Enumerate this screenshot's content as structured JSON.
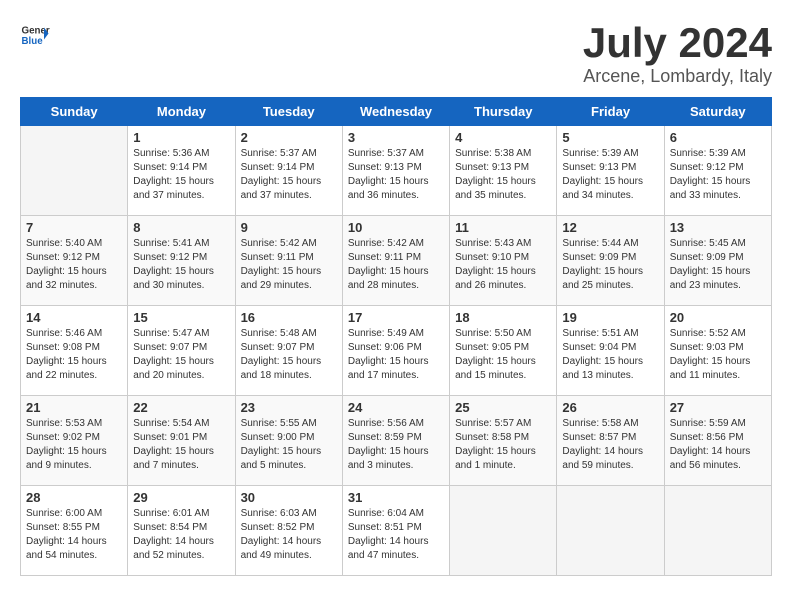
{
  "header": {
    "logo_general": "General",
    "logo_blue": "Blue",
    "month": "July 2024",
    "location": "Arcene, Lombardy, Italy"
  },
  "weekdays": [
    "Sunday",
    "Monday",
    "Tuesday",
    "Wednesday",
    "Thursday",
    "Friday",
    "Saturday"
  ],
  "weeks": [
    [
      {
        "day": "",
        "info": ""
      },
      {
        "day": "1",
        "info": "Sunrise: 5:36 AM\nSunset: 9:14 PM\nDaylight: 15 hours\nand 37 minutes."
      },
      {
        "day": "2",
        "info": "Sunrise: 5:37 AM\nSunset: 9:14 PM\nDaylight: 15 hours\nand 37 minutes."
      },
      {
        "day": "3",
        "info": "Sunrise: 5:37 AM\nSunset: 9:13 PM\nDaylight: 15 hours\nand 36 minutes."
      },
      {
        "day": "4",
        "info": "Sunrise: 5:38 AM\nSunset: 9:13 PM\nDaylight: 15 hours\nand 35 minutes."
      },
      {
        "day": "5",
        "info": "Sunrise: 5:39 AM\nSunset: 9:13 PM\nDaylight: 15 hours\nand 34 minutes."
      },
      {
        "day": "6",
        "info": "Sunrise: 5:39 AM\nSunset: 9:12 PM\nDaylight: 15 hours\nand 33 minutes."
      }
    ],
    [
      {
        "day": "7",
        "info": "Sunrise: 5:40 AM\nSunset: 9:12 PM\nDaylight: 15 hours\nand 32 minutes."
      },
      {
        "day": "8",
        "info": "Sunrise: 5:41 AM\nSunset: 9:12 PM\nDaylight: 15 hours\nand 30 minutes."
      },
      {
        "day": "9",
        "info": "Sunrise: 5:42 AM\nSunset: 9:11 PM\nDaylight: 15 hours\nand 29 minutes."
      },
      {
        "day": "10",
        "info": "Sunrise: 5:42 AM\nSunset: 9:11 PM\nDaylight: 15 hours\nand 28 minutes."
      },
      {
        "day": "11",
        "info": "Sunrise: 5:43 AM\nSunset: 9:10 PM\nDaylight: 15 hours\nand 26 minutes."
      },
      {
        "day": "12",
        "info": "Sunrise: 5:44 AM\nSunset: 9:09 PM\nDaylight: 15 hours\nand 25 minutes."
      },
      {
        "day": "13",
        "info": "Sunrise: 5:45 AM\nSunset: 9:09 PM\nDaylight: 15 hours\nand 23 minutes."
      }
    ],
    [
      {
        "day": "14",
        "info": "Sunrise: 5:46 AM\nSunset: 9:08 PM\nDaylight: 15 hours\nand 22 minutes."
      },
      {
        "day": "15",
        "info": "Sunrise: 5:47 AM\nSunset: 9:07 PM\nDaylight: 15 hours\nand 20 minutes."
      },
      {
        "day": "16",
        "info": "Sunrise: 5:48 AM\nSunset: 9:07 PM\nDaylight: 15 hours\nand 18 minutes."
      },
      {
        "day": "17",
        "info": "Sunrise: 5:49 AM\nSunset: 9:06 PM\nDaylight: 15 hours\nand 17 minutes."
      },
      {
        "day": "18",
        "info": "Sunrise: 5:50 AM\nSunset: 9:05 PM\nDaylight: 15 hours\nand 15 minutes."
      },
      {
        "day": "19",
        "info": "Sunrise: 5:51 AM\nSunset: 9:04 PM\nDaylight: 15 hours\nand 13 minutes."
      },
      {
        "day": "20",
        "info": "Sunrise: 5:52 AM\nSunset: 9:03 PM\nDaylight: 15 hours\nand 11 minutes."
      }
    ],
    [
      {
        "day": "21",
        "info": "Sunrise: 5:53 AM\nSunset: 9:02 PM\nDaylight: 15 hours\nand 9 minutes."
      },
      {
        "day": "22",
        "info": "Sunrise: 5:54 AM\nSunset: 9:01 PM\nDaylight: 15 hours\nand 7 minutes."
      },
      {
        "day": "23",
        "info": "Sunrise: 5:55 AM\nSunset: 9:00 PM\nDaylight: 15 hours\nand 5 minutes."
      },
      {
        "day": "24",
        "info": "Sunrise: 5:56 AM\nSunset: 8:59 PM\nDaylight: 15 hours\nand 3 minutes."
      },
      {
        "day": "25",
        "info": "Sunrise: 5:57 AM\nSunset: 8:58 PM\nDaylight: 15 hours\nand 1 minute."
      },
      {
        "day": "26",
        "info": "Sunrise: 5:58 AM\nSunset: 8:57 PM\nDaylight: 14 hours\nand 59 minutes."
      },
      {
        "day": "27",
        "info": "Sunrise: 5:59 AM\nSunset: 8:56 PM\nDaylight: 14 hours\nand 56 minutes."
      }
    ],
    [
      {
        "day": "28",
        "info": "Sunrise: 6:00 AM\nSunset: 8:55 PM\nDaylight: 14 hours\nand 54 minutes."
      },
      {
        "day": "29",
        "info": "Sunrise: 6:01 AM\nSunset: 8:54 PM\nDaylight: 14 hours\nand 52 minutes."
      },
      {
        "day": "30",
        "info": "Sunrise: 6:03 AM\nSunset: 8:52 PM\nDaylight: 14 hours\nand 49 minutes."
      },
      {
        "day": "31",
        "info": "Sunrise: 6:04 AM\nSunset: 8:51 PM\nDaylight: 14 hours\nand 47 minutes."
      },
      {
        "day": "",
        "info": ""
      },
      {
        "day": "",
        "info": ""
      },
      {
        "day": "",
        "info": ""
      }
    ]
  ]
}
